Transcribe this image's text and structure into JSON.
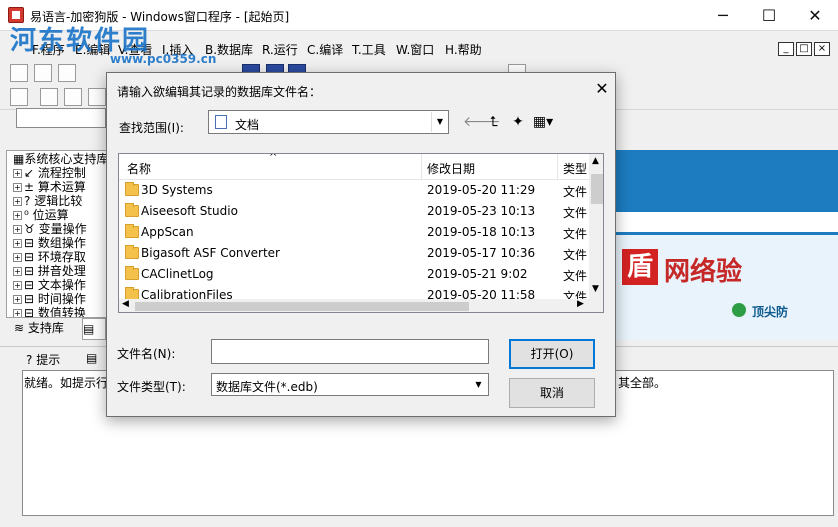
{
  "window": {
    "title": "易语言-加密狗版 - Windows窗口程序 - [起始页]",
    "minimize": "─",
    "maximize": "☐",
    "close": "✕"
  },
  "watermark": {
    "text": "河东软件园",
    "site": "www.pc0359.cn"
  },
  "menu": {
    "items": [
      "F.程序",
      "E.编辑",
      "V.查看",
      "I.插入",
      "B.数据库",
      "R.运行",
      "C.编译",
      "T.工具",
      "W.窗口",
      "H.帮助"
    ]
  },
  "mdi_buttons": [
    "_",
    "□",
    "×"
  ],
  "tree": {
    "items": [
      {
        "label": "系统核心支持库",
        "icon": "library-icon"
      },
      {
        "label": "流程控制",
        "icon": "arrow-icon"
      },
      {
        "label": "算术运算",
        "icon": "math-icon"
      },
      {
        "label": "逻辑比较",
        "icon": "question-icon"
      },
      {
        "label": "位运算",
        "icon": "bit-icon"
      },
      {
        "label": "变量操作",
        "icon": "variable-icon"
      },
      {
        "label": "数组操作",
        "icon": "doc-icon"
      },
      {
        "label": "环境存取",
        "icon": "doc-icon"
      },
      {
        "label": "拼音处理",
        "icon": "doc-icon"
      },
      {
        "label": "文本操作",
        "icon": "doc-icon"
      },
      {
        "label": "时间操作",
        "icon": "doc-icon"
      },
      {
        "label": "数值转换",
        "icon": "doc-icon"
      }
    ]
  },
  "panel_tabs": {
    "support_lib": "支持库"
  },
  "banner": {
    "logo": "盾",
    "text": "网络验",
    "sub": "顶尖防"
  },
  "bottom_tabs": {
    "hint": "提示"
  },
  "output": {
    "text": "就绪。如提示行",
    "tail": "其全部。"
  },
  "dialog": {
    "title": "请输入欲编辑其记录的数据库文件名：",
    "close": "✕",
    "lookin_label": "查找范围(I):",
    "lookin_value": "文档",
    "columns": {
      "name": "名称",
      "date": "修改日期",
      "type": "类型"
    },
    "files": [
      {
        "name": "3D Systems",
        "date": "2019-05-20 11:29",
        "type": "文件"
      },
      {
        "name": "Aiseesoft Studio",
        "date": "2019-05-23 10:13",
        "type": "文件"
      },
      {
        "name": "AppScan",
        "date": "2019-05-18 10:13",
        "type": "文件"
      },
      {
        "name": "Bigasoft ASF Converter",
        "date": "2019-05-17 10:36",
        "type": "文件"
      },
      {
        "name": "CAClinetLog",
        "date": "2019-05-21 9:02",
        "type": "文件"
      },
      {
        "name": "CalibrationFiles",
        "date": "2019-05-20 11:58",
        "type": "文件"
      }
    ],
    "filename_label": "文件名(N):",
    "filename_value": "",
    "filetype_label": "文件类型(T):",
    "filetype_value": "数据库文件(*.edb)",
    "open_button": "打开(O)",
    "cancel_button": "取消"
  }
}
